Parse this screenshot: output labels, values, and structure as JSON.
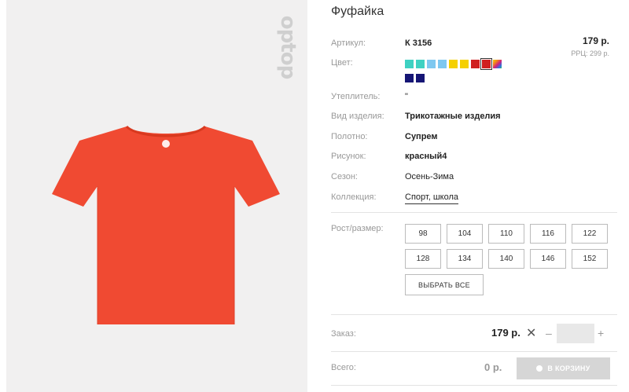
{
  "brand": {
    "logo_text": "optop"
  },
  "product": {
    "title": "Фуфайка",
    "article_label": "Артикул:",
    "article_value": "К 3156",
    "price": "179 р.",
    "rrp": "РРЦ: 299 р.",
    "color_label": "Цвет:",
    "colors": [
      "#3ed1c2",
      "#3ed1c2",
      "#7ec8f0",
      "#7ec8f0",
      "#f5d000",
      "#f5d000",
      "#d02020",
      "#d02020",
      "rainbow",
      "#151575",
      "#151575"
    ],
    "selected_color_index": 7,
    "insulation_label": "Утеплитель:",
    "insulation_value": "\"",
    "type_label": "Вид изделия:",
    "type_value": "Трикотажные изделия",
    "fabric_label": "Полотно:",
    "fabric_value": "Супрем",
    "pattern_label": "Рисунок:",
    "pattern_value": "красный4",
    "season_label": "Сезон:",
    "season_value": "Осень-Зима",
    "collection_label": "Коллекция:",
    "collection_value": "Спорт, школа",
    "garment_color": "#f04a32"
  },
  "sizes": {
    "label": "Рост/размер:",
    "items": [
      "98",
      "104",
      "110",
      "116",
      "122",
      "128",
      "134",
      "140",
      "146",
      "152"
    ],
    "select_all": "ВЫБРАТЬ ВСЕ"
  },
  "order": {
    "label": "Заказ:",
    "price": "179 р.",
    "times": "✕",
    "minus": "–",
    "quantity": "",
    "plus": "+"
  },
  "total": {
    "label": "Всего:",
    "value": "0 р.",
    "cart_button": "В КОРЗИНУ"
  }
}
